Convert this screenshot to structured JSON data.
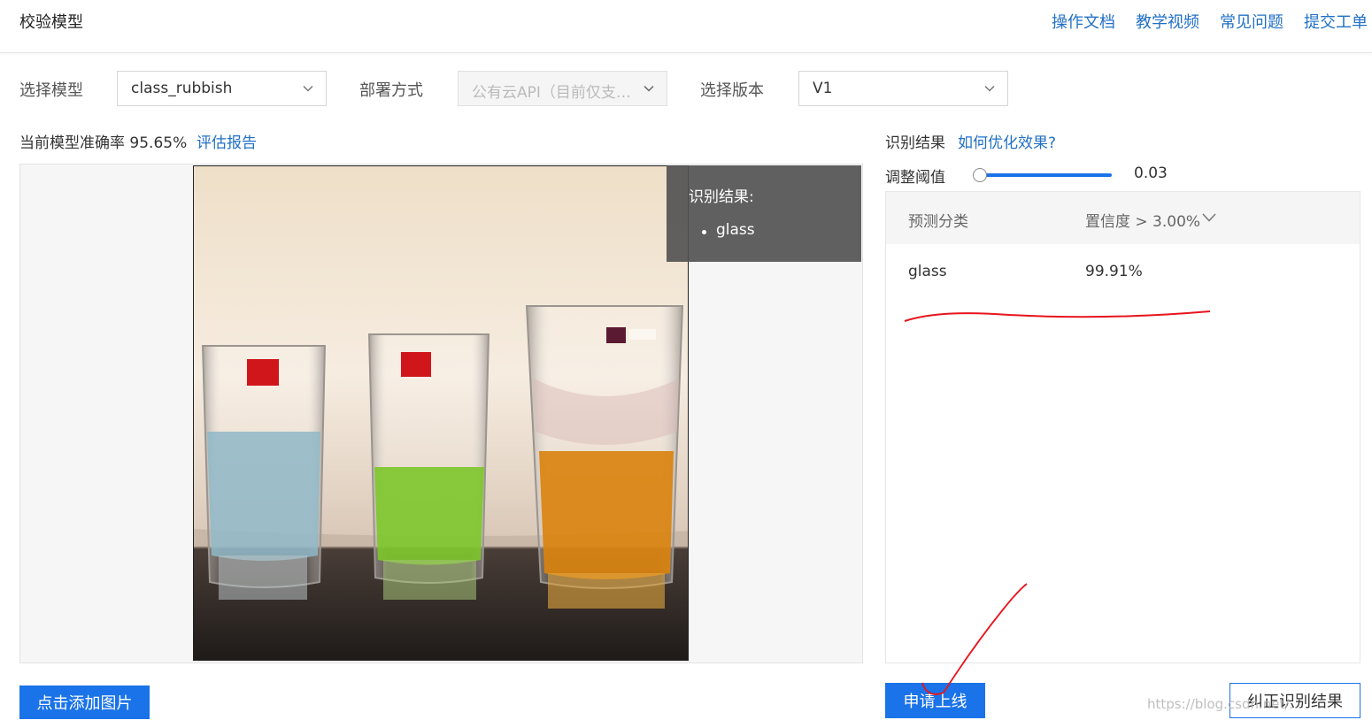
{
  "header": {
    "title": "校验模型",
    "links": [
      "操作文档",
      "教学视频",
      "常见问题",
      "提交工单"
    ]
  },
  "selectors": {
    "model_label": "选择模型",
    "model_value": "class_rubbish",
    "deploy_label": "部署方式",
    "deploy_value": "公有云API（目前仅支…",
    "version_label": "选择版本",
    "version_value": "V1"
  },
  "accuracy": {
    "label": "当前模型准确率 95.65%",
    "report_link": "评估报告"
  },
  "overlay": {
    "title": "识别结果:",
    "items": [
      "glass"
    ]
  },
  "results": {
    "label": "识别结果",
    "optimize_link": "如何优化效果?",
    "threshold_label": "调整阈值",
    "threshold_value": "0.03",
    "threshold_level": 0.03,
    "columns": [
      "预测分类",
      "置信度 > 3.00%"
    ],
    "rows": [
      {
        "class": "glass",
        "confidence": "99.91%"
      }
    ]
  },
  "buttons": {
    "add_image": "点击添加图片",
    "apply_online": "申请上线",
    "correct_result": "纠正识别结果"
  },
  "watermark": "https://blog.csdn.net/...",
  "colors": {
    "accent": "#1a73e8",
    "link": "#2270c6",
    "annotation": "#e8141c"
  }
}
